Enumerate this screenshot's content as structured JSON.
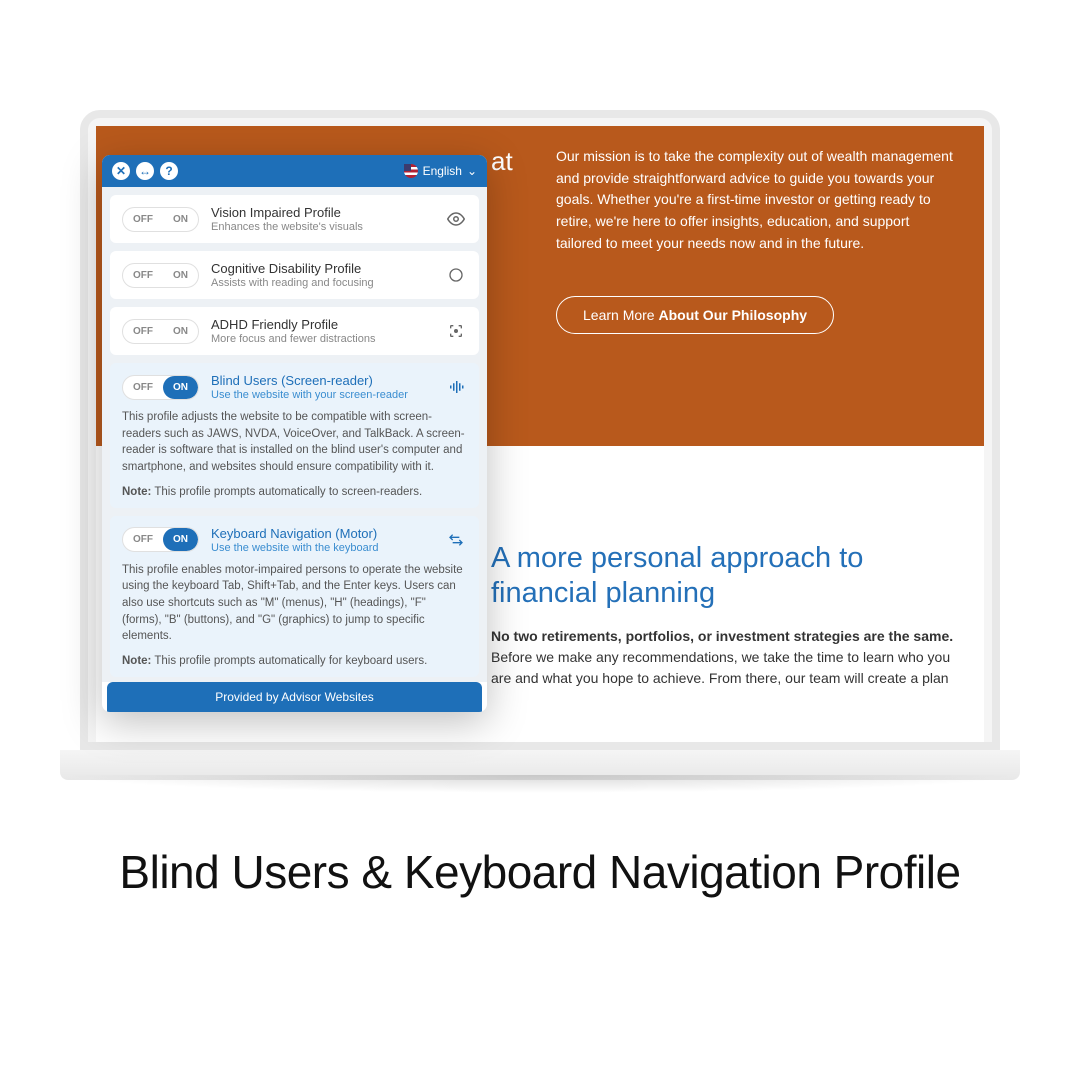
{
  "caption": "Blind Users & Keyboard Navigation Profile",
  "hero": {
    "fragment_text": "at",
    "mission": "Our mission is to take the complexity out of wealth management and provide straightforward advice to guide you towards your goals. Whether you're a first-time investor or getting ready to retire, we're here to offer insights, education, and support tailored to meet your needs now and in the future.",
    "cta_prefix": "Learn More ",
    "cta_bold": "About Our Philosophy"
  },
  "section": {
    "heading": "A more personal approach to financial planning",
    "body_bold": "No two retirements, portfolios, or investment strategies are the same.",
    "body_rest": " Before we make any recommendations, we take the time to learn who you are and what you hope to achieve. From there, our team will create a plan"
  },
  "widget": {
    "language": "English",
    "footer": "Provided by Advisor Websites",
    "profiles": {
      "vision": {
        "title": "Vision Impaired Profile",
        "sub": "Enhances the website's visuals",
        "off": "OFF",
        "on": "ON"
      },
      "cognitive": {
        "title": "Cognitive Disability Profile",
        "sub": "Assists with reading and focusing",
        "off": "OFF",
        "on": "ON"
      },
      "adhd": {
        "title": "ADHD Friendly Profile",
        "sub": "More focus and fewer distractions",
        "off": "OFF",
        "on": "ON"
      },
      "blind": {
        "title": "Blind Users (Screen-reader)",
        "sub": "Use the website with your screen-reader",
        "off": "OFF",
        "on": "ON",
        "desc": "This profile adjusts the website to be compatible with screen-readers such as JAWS, NVDA, VoiceOver, and TalkBack. A screen-reader is software that is installed on the blind user's computer and smartphone, and websites should ensure compatibility with it.",
        "note_label": "Note:",
        "note": " This profile prompts automatically to screen-readers."
      },
      "keyboard": {
        "title": "Keyboard Navigation (Motor)",
        "sub": "Use the website with the keyboard",
        "off": "OFF",
        "on": "ON",
        "desc": "This profile enables motor-impaired persons to operate the website using the keyboard Tab, Shift+Tab, and the Enter keys. Users can also use shortcuts such as \"M\" (menus), \"H\" (headings), \"F\" (forms), \"B\" (buttons), and \"G\" (graphics) to jump to specific elements.",
        "note_label": "Note:",
        "note": " This profile prompts automatically for keyboard users."
      }
    }
  }
}
